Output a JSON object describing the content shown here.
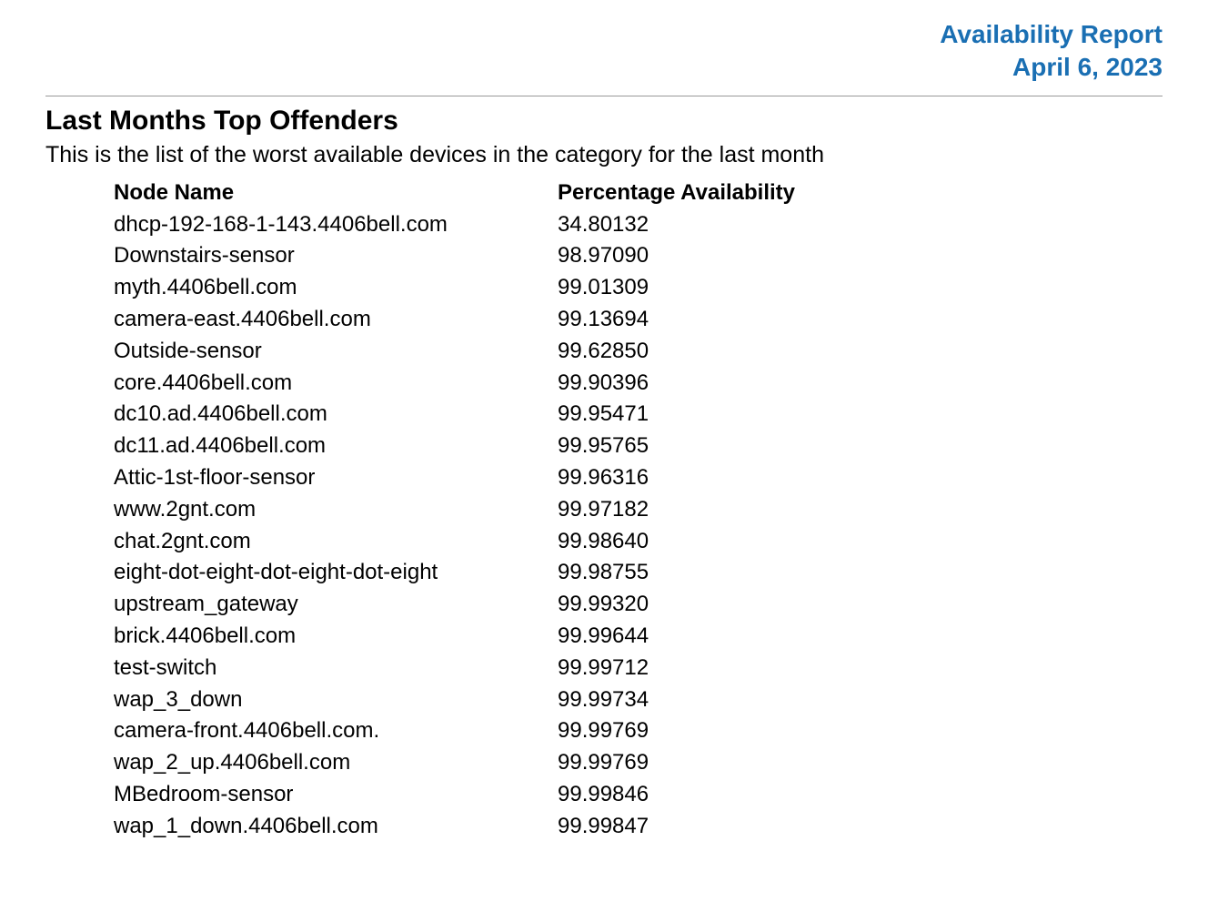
{
  "header": {
    "title": "Availability Report",
    "date": "April 6, 2023"
  },
  "section": {
    "title": "Last Months Top Offenders",
    "description": "This is the list of the worst available devices in the category for the last month"
  },
  "table": {
    "columns": {
      "node": "Node Name",
      "pct": "Percentage Availability"
    },
    "rows": [
      {
        "node": "dhcp-192-168-1-143.4406bell.com",
        "pct": "34.80132"
      },
      {
        "node": "Downstairs-sensor",
        "pct": "98.97090"
      },
      {
        "node": "myth.4406bell.com",
        "pct": "99.01309"
      },
      {
        "node": "camera-east.4406bell.com",
        "pct": "99.13694"
      },
      {
        "node": "Outside-sensor",
        "pct": "99.62850"
      },
      {
        "node": "core.4406bell.com",
        "pct": "99.90396"
      },
      {
        "node": "dc10.ad.4406bell.com",
        "pct": "99.95471"
      },
      {
        "node": "dc11.ad.4406bell.com",
        "pct": "99.95765"
      },
      {
        "node": "Attic-1st-floor-sensor",
        "pct": "99.96316"
      },
      {
        "node": "www.2gnt.com",
        "pct": "99.97182"
      },
      {
        "node": "chat.2gnt.com",
        "pct": "99.98640"
      },
      {
        "node": "eight-dot-eight-dot-eight-dot-eight",
        "pct": "99.98755"
      },
      {
        "node": "upstream_gateway",
        "pct": "99.99320"
      },
      {
        "node": "brick.4406bell.com",
        "pct": "99.99644"
      },
      {
        "node": "test-switch",
        "pct": "99.99712"
      },
      {
        "node": "wap_3_down",
        "pct": "99.99734"
      },
      {
        "node": "camera-front.4406bell.com.",
        "pct": "99.99769"
      },
      {
        "node": "wap_2_up.4406bell.com",
        "pct": "99.99769"
      },
      {
        "node": "MBedroom-sensor",
        "pct": "99.99846"
      },
      {
        "node": "wap_1_down.4406bell.com",
        "pct": "99.99847"
      }
    ]
  }
}
